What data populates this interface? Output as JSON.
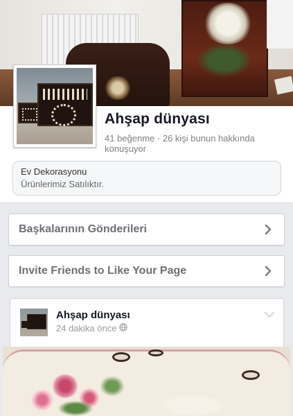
{
  "page": {
    "name": "Ahşap dünyası",
    "stats": "41 beğenme · 26 kişi bunun hakkında konuşuyor"
  },
  "about": {
    "category": "Ev Dekorasyonu",
    "description": "Ürünlerimiz Satılıktır."
  },
  "actions": [
    {
      "label": "Başkalarının Gönderileri"
    },
    {
      "label": "Invite Friends to Like Your Page"
    }
  ],
  "post": {
    "author": "Ahşap dünyası",
    "time": "24 dakika önce"
  },
  "icons": {
    "chevron": "chevron-right-icon",
    "globe": "globe-icon",
    "menu": "chevron-down-icon"
  },
  "colors": {
    "background": "#e9eaed",
    "primary_text": "#141823",
    "secondary_text": "#7f7f7f",
    "action_text": "#6d6f73"
  }
}
